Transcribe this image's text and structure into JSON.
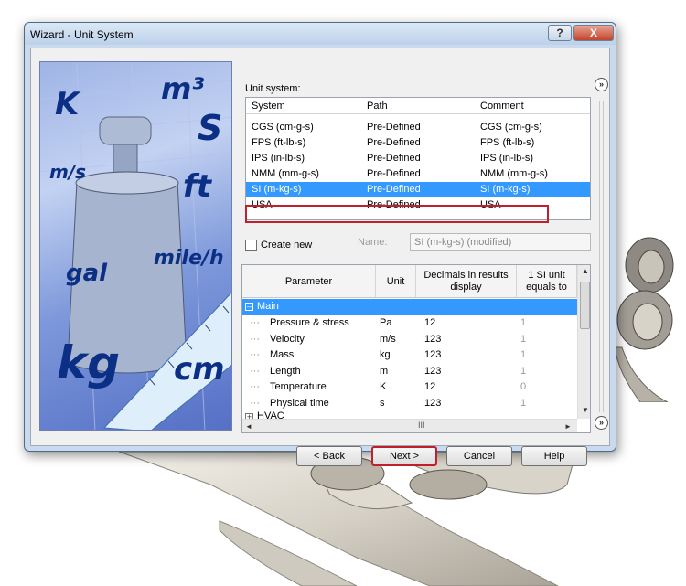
{
  "window": {
    "title": "Wizard - Unit System",
    "help_glyph": "?",
    "close_glyph": "X"
  },
  "illustration": {
    "units": [
      "K",
      "m³",
      "S",
      "m/s",
      "ft",
      "mile/h",
      "gal",
      "kg",
      "cm"
    ]
  },
  "unit_system": {
    "label": "Unit system:",
    "columns": [
      "System",
      "Path",
      "Comment"
    ],
    "rows": [
      {
        "system": "CGS (cm-g-s)",
        "path": "Pre-Defined",
        "comment": "CGS (cm-g-s)"
      },
      {
        "system": "FPS (ft-lb-s)",
        "path": "Pre-Defined",
        "comment": "FPS (ft-lb-s)"
      },
      {
        "system": "IPS (in-lb-s)",
        "path": "Pre-Defined",
        "comment": "IPS (in-lb-s)"
      },
      {
        "system": "NMM (mm-g-s)",
        "path": "Pre-Defined",
        "comment": "NMM (mm-g-s)"
      },
      {
        "system": "SI (m-kg-s)",
        "path": "Pre-Defined",
        "comment": "SI (m-kg-s)"
      },
      {
        "system": "USA",
        "path": "Pre-Defined",
        "comment": "USA"
      }
    ],
    "selected_index": 4
  },
  "create_new": {
    "label": "Create new",
    "checked": false,
    "name_label": "Name:",
    "name_value": "SI (m-kg-s) (modified)"
  },
  "parameters": {
    "columns": {
      "parameter": "Parameter",
      "unit": "Unit",
      "decimals": "Decimals in results display",
      "si_equals": "1 SI unit equals to"
    },
    "groups": [
      {
        "name": "Main",
        "expanded": true,
        "rows": [
          {
            "name": "Pressure & stress",
            "unit": "Pa",
            "decimals": ".12",
            "si": "1"
          },
          {
            "name": "Velocity",
            "unit": "m/s",
            "decimals": ".123",
            "si": "1"
          },
          {
            "name": "Mass",
            "unit": "kg",
            "decimals": ".123",
            "si": "1"
          },
          {
            "name": "Length",
            "unit": "m",
            "decimals": ".123",
            "si": "1"
          },
          {
            "name": "Temperature",
            "unit": "K",
            "decimals": ".12",
            "si": "0"
          },
          {
            "name": "Physical time",
            "unit": "s",
            "decimals": ".123",
            "si": "1"
          }
        ]
      },
      {
        "name": "HVAC",
        "expanded": false,
        "rows": []
      }
    ],
    "hscroll_thumb": "III"
  },
  "buttons": {
    "back": "< Back",
    "next": "Next >",
    "cancel": "Cancel",
    "help": "Help"
  },
  "side_buttons": {
    "top": "»",
    "bottom": "»"
  },
  "colors": {
    "selection": "#3399ff",
    "highlight_outline": "#c0202c",
    "title_bar": "#c9daee"
  }
}
